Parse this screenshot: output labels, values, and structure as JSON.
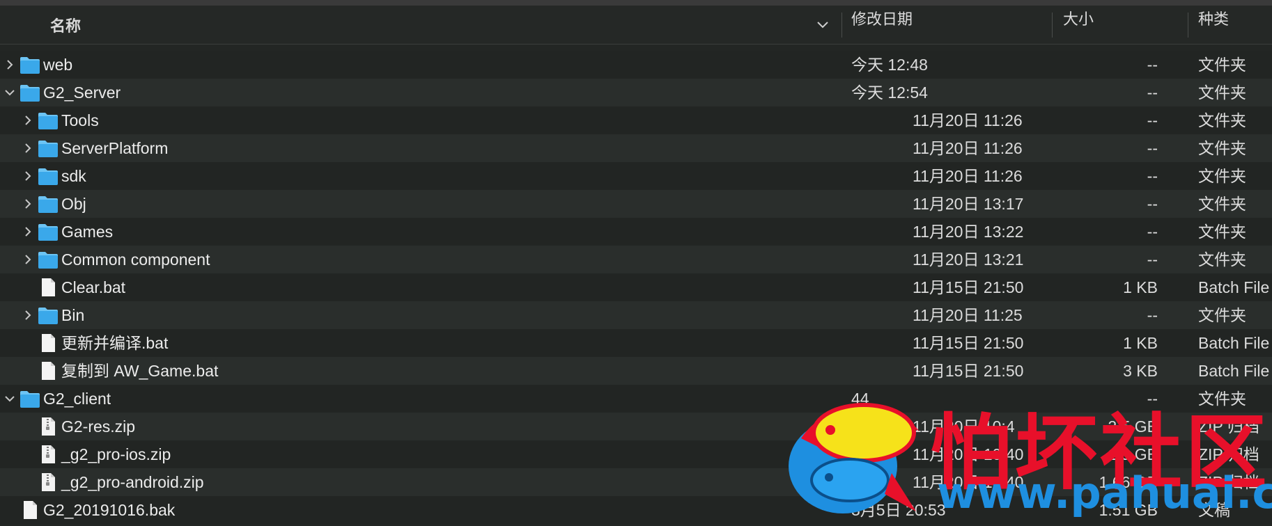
{
  "header": {
    "name_label": "名称",
    "date_label": "修改日期",
    "size_label": "大小",
    "kind_label": "种类"
  },
  "rows": [
    {
      "name": "web",
      "date": "今天 12:48",
      "size": "--",
      "kind": "文件夹",
      "level": 0,
      "type": "folder",
      "disclosure": "right"
    },
    {
      "name": "G2_Server",
      "date": "今天 12:54",
      "size": "--",
      "kind": "文件夹",
      "level": 0,
      "type": "folder",
      "disclosure": "down"
    },
    {
      "name": "Tools",
      "date": "11月20日 11:26",
      "size": "--",
      "kind": "文件夹",
      "level": 1,
      "type": "folder",
      "disclosure": "right"
    },
    {
      "name": "ServerPlatform",
      "date": "11月20日 11:26",
      "size": "--",
      "kind": "文件夹",
      "level": 1,
      "type": "folder",
      "disclosure": "right"
    },
    {
      "name": "sdk",
      "date": "11月20日 11:26",
      "size": "--",
      "kind": "文件夹",
      "level": 1,
      "type": "folder",
      "disclosure": "right"
    },
    {
      "name": "Obj",
      "date": "11月20日 13:17",
      "size": "--",
      "kind": "文件夹",
      "level": 1,
      "type": "folder",
      "disclosure": "right"
    },
    {
      "name": "Games",
      "date": "11月20日 13:22",
      "size": "--",
      "kind": "文件夹",
      "level": 1,
      "type": "folder",
      "disclosure": "right"
    },
    {
      "name": "Common component",
      "date": "11月20日 13:21",
      "size": "--",
      "kind": "文件夹",
      "level": 1,
      "type": "folder",
      "disclosure": "right"
    },
    {
      "name": "Clear.bat",
      "date": "11月15日 21:50",
      "size": "1 KB",
      "kind": "Batch File",
      "level": 1,
      "type": "file",
      "disclosure": "none"
    },
    {
      "name": "Bin",
      "date": "11月20日 11:25",
      "size": "--",
      "kind": "文件夹",
      "level": 1,
      "type": "folder",
      "disclosure": "right"
    },
    {
      "name": "更新并编译.bat",
      "date": "11月15日 21:50",
      "size": "1 KB",
      "kind": "Batch File",
      "level": 1,
      "type": "file",
      "disclosure": "none"
    },
    {
      "name": "复制到 AW_Game.bat",
      "date": "11月15日 21:50",
      "size": "3 KB",
      "kind": "Batch File",
      "level": 1,
      "type": "file",
      "disclosure": "none"
    },
    {
      "name": "G2_client",
      "date": "44",
      "size": "--",
      "kind": "文件夹",
      "level": 0,
      "type": "folder",
      "disclosure": "down"
    },
    {
      "name": "G2-res.zip",
      "date": "11月20日 10:4",
      "size": "2.5 GB",
      "kind": "ZIP 归档",
      "level": 1,
      "type": "zip",
      "disclosure": "none"
    },
    {
      "name": "_g2_pro-ios.zip",
      "date": "11月20日 10:40",
      "size": "1.9 GB",
      "kind": "ZIP 归档",
      "level": 1,
      "type": "zip",
      "disclosure": "none"
    },
    {
      "name": "_g2_pro-android.zip",
      "date": "11月20日 10:40",
      "size": "1.66 GB",
      "kind": "ZIP 归档",
      "level": 1,
      "type": "zip",
      "disclosure": "none"
    },
    {
      "name": "G2_20191016.bak",
      "date": "3月5日 20:53",
      "size": "1.51 GB",
      "kind": "文稿",
      "level": 0,
      "type": "file",
      "disclosure": "none"
    }
  ],
  "watermark": {
    "title": "怕坏社区",
    "url": "www.pahuai.com"
  },
  "colors": {
    "folder": "#3aa8ea",
    "folder_tab": "#6cc4f4",
    "watermark_red": "#e8102a",
    "watermark_blue": "#1e8fe0",
    "watermark_yellow": "#f6e21a"
  }
}
